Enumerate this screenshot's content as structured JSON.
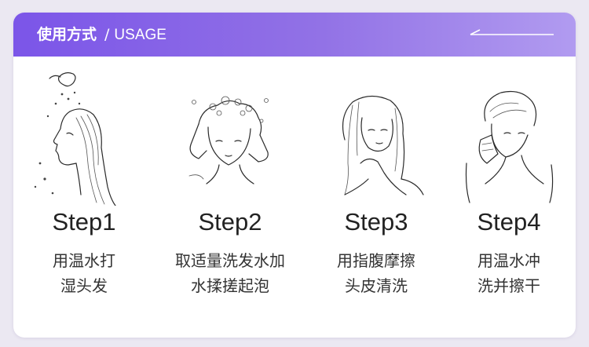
{
  "header": {
    "title_cn": "使用方式",
    "separator": "/",
    "title_en": "USAGE"
  },
  "colors": {
    "header_start": "#7b55e8",
    "header_end": "#b19bf0",
    "page_background": "#ebe8f2",
    "card_background": "#ffffff",
    "text": "#333333"
  },
  "steps": [
    {
      "label": "Step1",
      "desc_line1": "用温水打",
      "desc_line2": "湿头发",
      "icon": "shower-wet-hair-illustration"
    },
    {
      "label": "Step2",
      "desc_line1": "取适量洗发水加",
      "desc_line2": "水揉搓起泡",
      "icon": "lather-shampoo-illustration"
    },
    {
      "label": "Step3",
      "desc_line1": "用指腹摩擦",
      "desc_line2": "头皮清洗",
      "icon": "scalp-massage-illustration"
    },
    {
      "label": "Step4",
      "desc_line1": "用温水冲",
      "desc_line2": "洗并擦干",
      "icon": "rinse-dry-illustration"
    }
  ]
}
